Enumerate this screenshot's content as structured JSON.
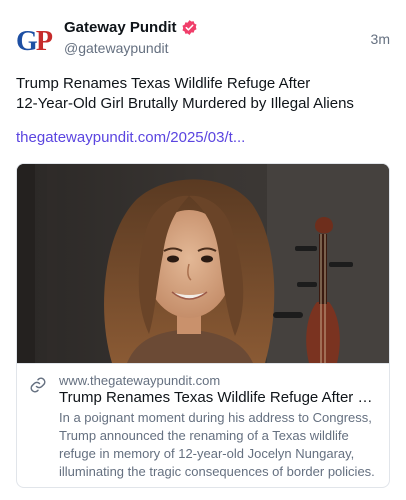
{
  "author": {
    "display_name": "Gateway Pundit",
    "handle": "@gatewaypundit",
    "avatar_text_g": "G",
    "avatar_text_p": "P",
    "verified_color": "#f03e6a"
  },
  "post": {
    "timestamp": "3m",
    "text_line1": "Trump Renames Texas Wildlife Refuge After",
    "text_line2": "12-Year-Old Girl Brutally Murdered by Illegal Aliens",
    "link": "thegatewaypundit.com/2025/03/t..."
  },
  "card": {
    "image_icon": "photo-of-girl-with-cello",
    "link_icon": "link-icon",
    "domain": "www.thegatewaypundit.com",
    "title": "Trump Renames Texas Wildlife Refuge After 12…",
    "description": "In a poignant moment during his address to Congress, Trump announced the renaming of a Texas wildlife refuge in memory of 12-year-old Jocelyn Nungaray, illuminating the tragic consequences of border policies."
  },
  "colors": {
    "link": "#5b45e0",
    "muted": "#657080",
    "border": "#e1e5ea"
  }
}
